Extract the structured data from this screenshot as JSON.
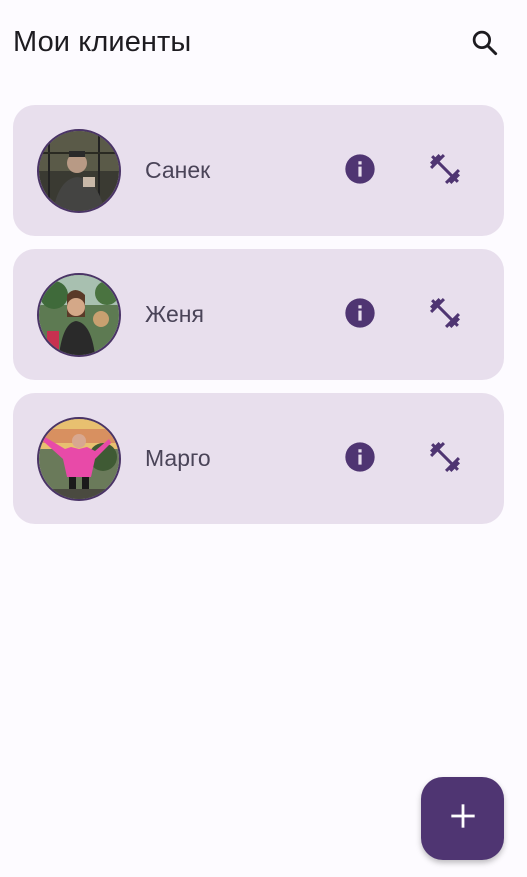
{
  "header": {
    "title": "Мои клиенты",
    "search_icon": "search-icon"
  },
  "colors": {
    "card_bg": "#e8dfed",
    "accent": "#4f3572",
    "fab_bg": "#4f3572",
    "text_primary": "#1d1b20",
    "text_secondary": "#4a4458"
  },
  "clients": [
    {
      "name": "Санек",
      "avatar": "avatar-photo",
      "info_icon": "info-icon",
      "workout_icon": "dumbbell-icon"
    },
    {
      "name": "Женя",
      "avatar": "avatar-photo",
      "info_icon": "info-icon",
      "workout_icon": "dumbbell-icon"
    },
    {
      "name": "Марго",
      "avatar": "avatar-photo",
      "info_icon": "info-icon",
      "workout_icon": "dumbbell-icon"
    }
  ],
  "fab": {
    "label": "+",
    "icon": "plus-icon"
  }
}
